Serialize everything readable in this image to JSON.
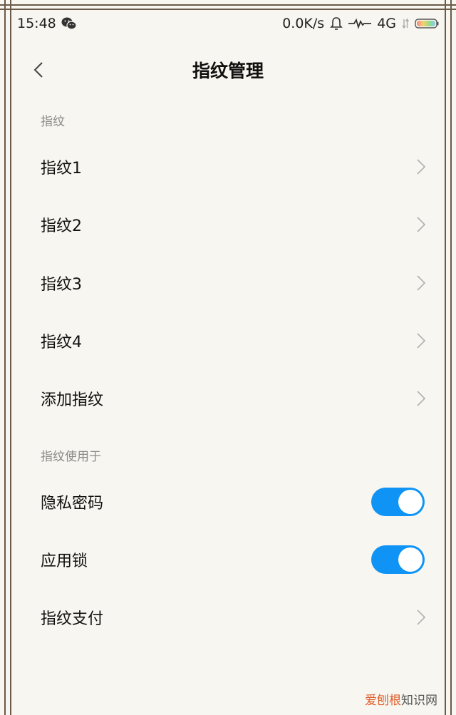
{
  "status_bar": {
    "time": "15:48",
    "network_speed": "0.0K/s",
    "network_type": "4G",
    "icons": [
      "wechat-icon",
      "bell-icon",
      "signal-wave-icon",
      "data-arrows-icon",
      "battery-icon"
    ]
  },
  "header": {
    "title": "指纹管理",
    "back_icon": "chevron-left-icon"
  },
  "fingerprints_section": {
    "header": "指纹",
    "items": [
      {
        "label": "指纹1"
      },
      {
        "label": "指纹2"
      },
      {
        "label": "指纹3"
      },
      {
        "label": "指纹4"
      },
      {
        "label": "添加指纹"
      }
    ]
  },
  "usage_section": {
    "header": "指纹使用于",
    "items": [
      {
        "label": "隐私密码",
        "toggle": true
      },
      {
        "label": "应用锁",
        "toggle": true
      },
      {
        "label": "指纹支付",
        "toggle": null
      }
    ]
  },
  "watermark": {
    "part1": "爱刨根",
    "part2": "知识网"
  },
  "colors": {
    "background": "#f7f6f0",
    "toggle_on": "#0f94f5",
    "section_header": "#8a8a8a",
    "frame": "#6b5a48"
  }
}
